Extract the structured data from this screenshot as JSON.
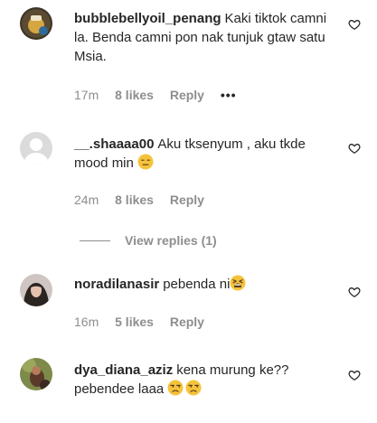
{
  "comments": [
    {
      "username": "bubblebellyoil_penang",
      "text": "Kaki tiktok camni la. Benda camni pon nak tunjuk gtaw satu Msia.",
      "time": "17m",
      "likes": "8 likes",
      "reply": "Reply",
      "more": "•••"
    },
    {
      "username": "__.shaaaa00",
      "text": "Aku tksenyum , aku tkde mood min",
      "emoji": "expressionless-face",
      "time": "24m",
      "likes": "8 likes",
      "reply": "Reply"
    },
    {
      "username": "noradilanasir",
      "text": "pebenda ni",
      "emoji": "tired-face",
      "time": "16m",
      "likes": "5 likes",
      "reply": "Reply"
    },
    {
      "username": "dya_diana_aziz",
      "text": "kena murung ke?? pebendee laaa",
      "emoji": "unamused-face",
      "time": null,
      "likes": null,
      "reply": null
    }
  ],
  "view_replies": "View replies (1)",
  "colors": {
    "text": "#262626",
    "secondary": "#8e8e8e",
    "emoji_yellow": "#f5c33b"
  }
}
